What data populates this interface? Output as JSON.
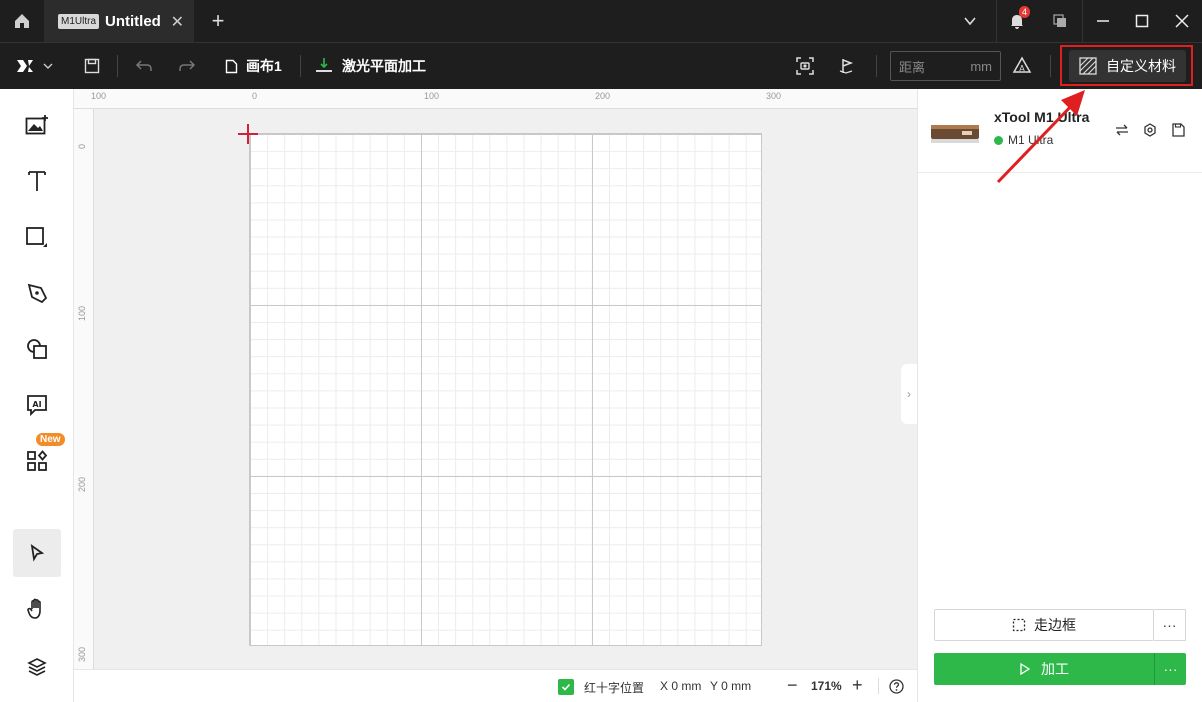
{
  "titlebar": {
    "tab_badge": "M1Ultra",
    "tab_title": "Untitled",
    "notification_count": "4"
  },
  "toolbar": {
    "canvas_label": "画布1",
    "mode_label": "激光平面加工",
    "distance_placeholder": "距离",
    "distance_unit": "mm",
    "custom_material_label": "自定义材料"
  },
  "ruler": {
    "top": [
      "100",
      "0",
      "100",
      "200",
      "300"
    ],
    "left": [
      "0",
      "100",
      "200",
      "300"
    ]
  },
  "sidebar": {
    "new_badge": "New"
  },
  "statusbar": {
    "crosshair_label": "红十字位置",
    "x_pos": "X 0 mm",
    "y_pos": "Y 0 mm",
    "zoom": "171%"
  },
  "device": {
    "name": "xTool M1 Ultra",
    "status": "M1 Ultra"
  },
  "actions": {
    "frame_label": "走边框",
    "process_label": "加工",
    "more_label": "···"
  },
  "colors": {
    "accent_green": "#2eb84a",
    "highlight_red": "#e02020",
    "dark_bg": "#1e1e1e"
  }
}
